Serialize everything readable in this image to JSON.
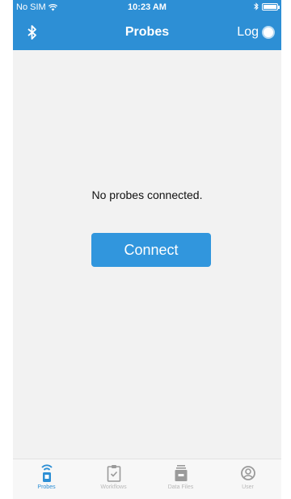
{
  "status_bar": {
    "carrier": "No SIM",
    "time": "10:23 AM"
  },
  "nav": {
    "title": "Probes",
    "left_icon": "bluetooth-icon",
    "right_label": "Log"
  },
  "main": {
    "empty_message": "No probes connected.",
    "connect_label": "Connect"
  },
  "tabs": [
    {
      "label": "Probes",
      "icon": "probe-icon",
      "active": true
    },
    {
      "label": "Workflows",
      "icon": "clipboard-check-icon",
      "active": false
    },
    {
      "label": "Data Files",
      "icon": "data-files-icon",
      "active": false
    },
    {
      "label": "User",
      "icon": "user-icon",
      "active": false
    }
  ],
  "colors": {
    "accent": "#2d8fd5",
    "button": "#3196dd",
    "background": "#f2f2f2",
    "tab_inactive": "#b8b8b8"
  }
}
